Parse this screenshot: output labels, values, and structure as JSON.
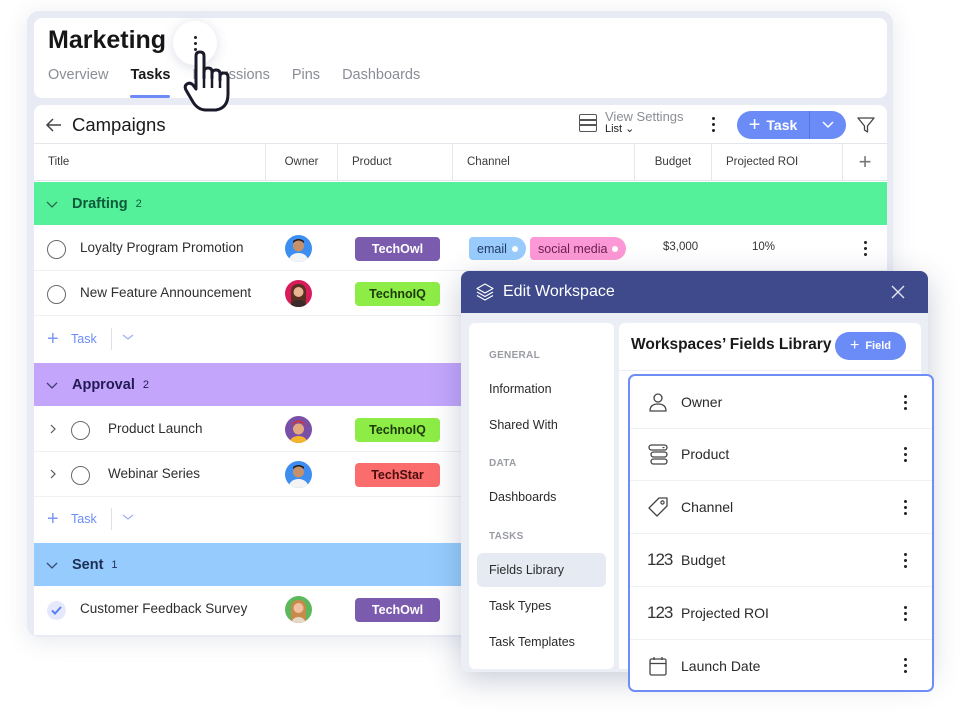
{
  "workspace": {
    "title": "Marketing",
    "tabs": [
      {
        "label": "Overview",
        "active": false
      },
      {
        "label": "Tasks",
        "active": true
      },
      {
        "label": "Discussions",
        "active": false
      },
      {
        "label": "Pins",
        "active": false
      },
      {
        "label": "Dashboards",
        "active": false
      }
    ]
  },
  "toolbar": {
    "list_title": "Campaigns",
    "view_settings_label": "View Settings",
    "view_settings_value": "List",
    "task_button_label": "Task"
  },
  "columns": [
    "Title",
    "Owner",
    "Product",
    "Channel",
    "Budget",
    "Projected ROI"
  ],
  "groups": [
    {
      "name": "Drafting",
      "count": "2",
      "color": "#54f09a",
      "text_color": "#0f5a39",
      "rows": [
        {
          "title": "Loyalty Program Promotion",
          "product": "TechOwl",
          "channels": [
            "email",
            "social media"
          ],
          "budget": "$3,000",
          "roi": "10%"
        },
        {
          "title": "New Feature Announcement",
          "product": "TechnoIQ"
        }
      ],
      "add_label": "Task"
    },
    {
      "name": "Approval",
      "count": "2",
      "color": "#c3a6fc",
      "text_color": "#221a55",
      "rows": [
        {
          "title": "Product Launch",
          "product": "TechnoIQ"
        },
        {
          "title": "Webinar Series",
          "product": "TechStar"
        }
      ],
      "add_label": "Task"
    },
    {
      "name": "Sent",
      "count": "1",
      "color": "#96ccfd",
      "text_color": "#1d2e55",
      "rows": [
        {
          "title": "Customer Feedback Survey",
          "product": "TechOwl",
          "done": true
        }
      ]
    }
  ],
  "product_colors": {
    "TechOwl": {
      "bg": "#7b5bad",
      "fg": "#ffffff"
    },
    "TechnoIQ": {
      "bg": "#8ded46",
      "fg": "#1d3a0a"
    },
    "TechStar": {
      "bg": "#fb6d6d",
      "fg": "#4a0d0d"
    }
  },
  "channel_colors": {
    "email": {
      "bg": "#99ccfd",
      "fg": "#223a66"
    },
    "social media": {
      "bg": "#fd98d6",
      "fg": "#6a1f4f"
    }
  },
  "dialog": {
    "title": "Edit Workspace",
    "sections": [
      {
        "label": "GENERAL",
        "items": [
          "Information",
          "Shared With"
        ]
      },
      {
        "label": "DATA",
        "items": [
          "Dashboards"
        ]
      },
      {
        "label": "TASKS",
        "items": [
          "Fields Library",
          "Task Types",
          "Task Templates"
        ]
      }
    ],
    "active_item": "Fields Library",
    "library_title": "Workspaces’ Fields Library",
    "add_field_label": "Field",
    "fields": [
      {
        "label": "Owner",
        "icon": "person-icon"
      },
      {
        "label": "Product",
        "icon": "dropdown-list-icon"
      },
      {
        "label": "Channel",
        "icon": "tag-icon"
      },
      {
        "label": "Budget",
        "icon": "number-icon",
        "glyph": "123"
      },
      {
        "label": "Projected ROI",
        "icon": "number-icon",
        "glyph": "123"
      },
      {
        "label": "Launch Date",
        "icon": "calendar-icon"
      }
    ]
  },
  "colors": {
    "accent": "#6b8cf7",
    "dialog_header": "#3e4a8c"
  }
}
